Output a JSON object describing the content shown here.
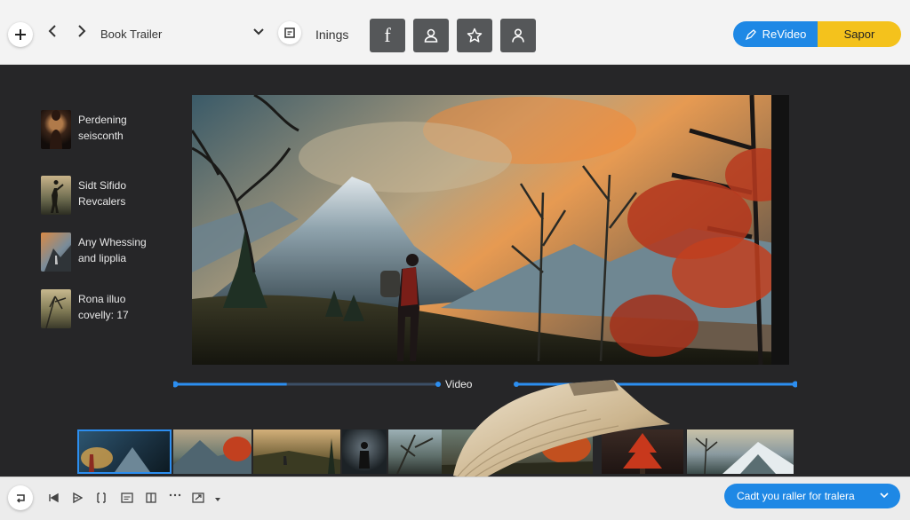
{
  "header": {
    "title": "Book Trailer",
    "menu_label": "Inings",
    "tool_buttons": [
      {
        "icon": "facebook-icon",
        "glyph": "f"
      },
      {
        "icon": "user-icon"
      },
      {
        "icon": "star-icon"
      },
      {
        "icon": "person-icon"
      }
    ],
    "revideo_label": "ReVideo",
    "sapor_label": "Sapor"
  },
  "scenes": [
    {
      "line1": "Perdening",
      "line2": "seisconth"
    },
    {
      "line1": "Sidt Sifido",
      "line2": "Revcalers"
    },
    {
      "line1": "Any Whessing",
      "line2": "and lipplia"
    },
    {
      "line1": "Rona illuo",
      "line2": "covelly: 17"
    }
  ],
  "timeline": {
    "label": "Video",
    "progress": 0.18
  },
  "footer": {
    "cta_label": "Cadt you raller for tralera"
  },
  "colors": {
    "accent_blue": "#1e88e5",
    "accent_yellow": "#f4c21c",
    "dark_bg": "#262628"
  }
}
